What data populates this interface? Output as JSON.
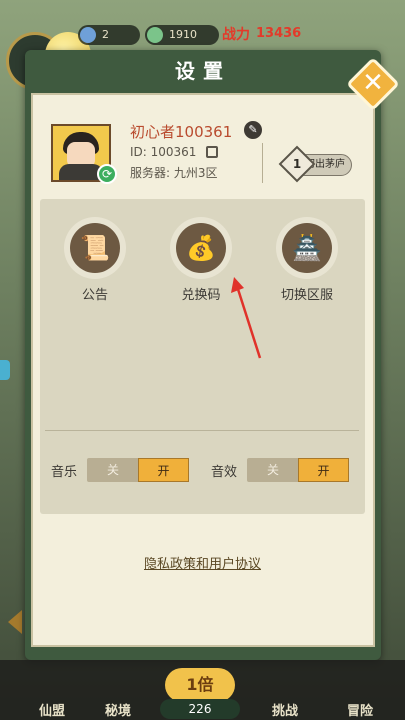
{
  "hud": {
    "resource1": "2",
    "resource2": "1910",
    "power_label": "战力",
    "power_value": "13436"
  },
  "modal": {
    "title": "设置",
    "close": "✕"
  },
  "profile": {
    "name": "初心者100361",
    "id_text": "ID: 100361",
    "server_text": "服务器: 九州3区",
    "rank_badge": "初出茅庐",
    "rank_number": "1"
  },
  "functions": [
    {
      "label": "公告",
      "icon": "scroll-icon",
      "glyph": "📜"
    },
    {
      "label": "兑换码",
      "icon": "money-bag-icon",
      "glyph": "💰"
    },
    {
      "label": "切换区服",
      "icon": "building-icon",
      "glyph": "🏯"
    }
  ],
  "settings": {
    "music_label": "音乐",
    "sfx_label": "音效",
    "off_label": "关",
    "on_label": "开",
    "music_on": true,
    "sfx_on": true
  },
  "privacy_link": "隐私政策和用户协议",
  "bottom_nav": {
    "items": [
      "仙盟",
      "秘境",
      "挑战",
      "冒险"
    ],
    "center_medal": "1倍",
    "center_count": "226"
  },
  "colors": {
    "accent": "#f0b03a",
    "name": "#b94b2e",
    "frame": "#3f5a3f",
    "annotation_arrow": "#e0322a"
  }
}
